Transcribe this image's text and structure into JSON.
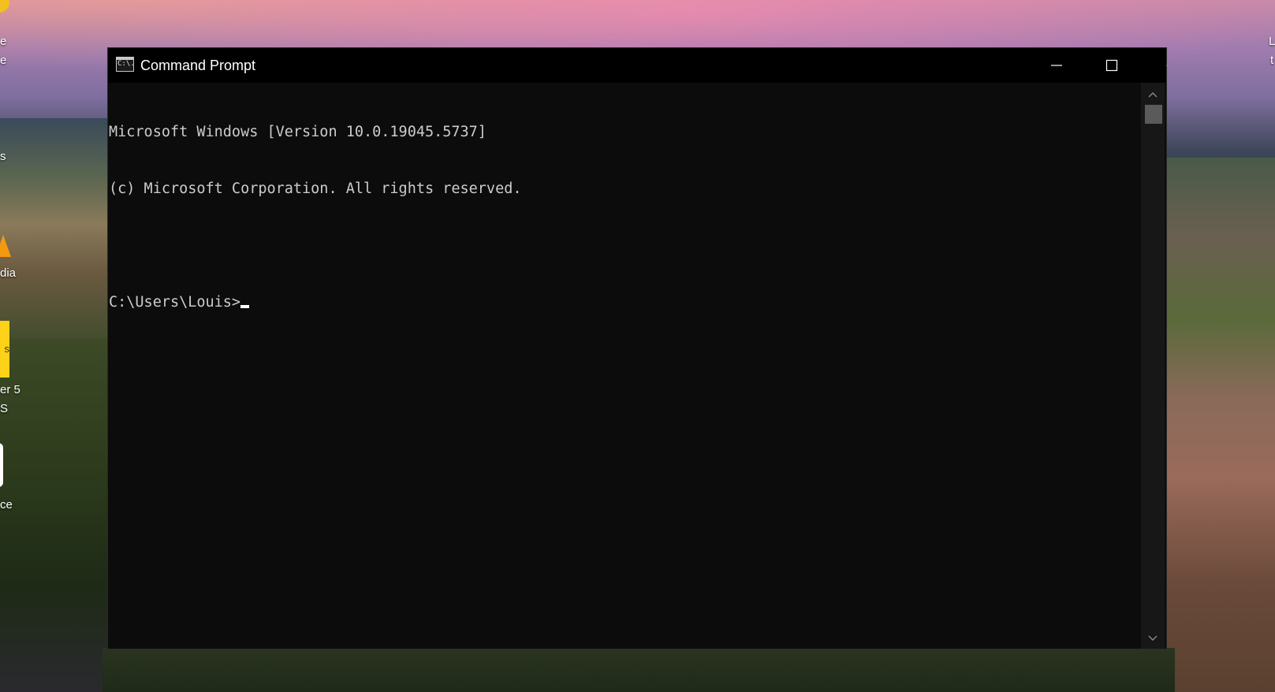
{
  "window": {
    "title": "Command Prompt",
    "app_icon_text": "C:\\."
  },
  "console": {
    "lines": [
      "Microsoft Windows [Version 10.0.19045.5737]",
      "(c) Microsoft Corporation. All rights reserved.",
      "",
      "C:\\Users\\Louis>"
    ]
  },
  "desktop": {
    "left_labels": [
      "e",
      "e",
      "s",
      "dia",
      "s",
      "er 5",
      "S",
      "ce"
    ],
    "right_labels": [
      "L",
      "t"
    ]
  },
  "icons": {
    "minimize": "minimize-icon",
    "maximize": "maximize-icon",
    "close": "close-icon",
    "scroll_up": "chevron-up-icon",
    "scroll_down": "chevron-down-icon"
  },
  "colors": {
    "console_bg": "#0c0c0c",
    "console_text": "#cccccc",
    "titlebar_bg": "#000000"
  }
}
